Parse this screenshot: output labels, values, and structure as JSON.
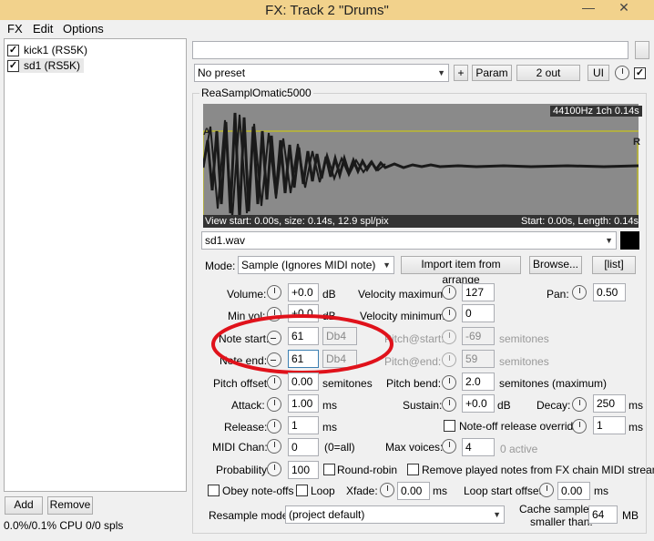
{
  "window": {
    "title": "FX: Track 2 \"Drums\"",
    "minimize": "—",
    "close": "✕"
  },
  "menu": {
    "fx": "FX",
    "edit": "Edit",
    "options": "Options"
  },
  "fx_list": [
    {
      "name": "kick1 (RS5K)",
      "checked": true
    },
    {
      "name": "sd1 (RS5K)",
      "checked": true
    }
  ],
  "footer": {
    "add": "Add",
    "remove": "Remove",
    "cpu": "0.0%/0.1% CPU 0/0 spls"
  },
  "top": {
    "preset": "No preset",
    "plus": "+",
    "param": "Param",
    "out": "2 out",
    "ui": "UI"
  },
  "plugin": {
    "name": "ReaSamplOmatic5000"
  },
  "waveform": {
    "info": "44100Hz 1ch 0.14s",
    "view": "View start: 0.00s, size: 0.14s, 12.9 spl/pix",
    "start": "Start: 0.00s, Length: 0.14s",
    "marker_a": "A",
    "marker_r": "R"
  },
  "file": {
    "name": "sd1.wav"
  },
  "mode": {
    "label": "Mode:",
    "value": "Sample (Ignores MIDI note)",
    "import": "Import item from arrange",
    "browse": "Browse...",
    "list": "[list]"
  },
  "params": {
    "volume_label": "Volume:",
    "volume": "+0.0",
    "db": "dB",
    "minvol_label": "Min vol:",
    "minvol": "+0.0",
    "vmax_label": "Velocity maximum:",
    "vmax": "127",
    "vmin_label": "Velocity minimum:",
    "vmin": "0",
    "pan_label": "Pan:",
    "pan": "0.50",
    "note_start_label": "Note start:",
    "note_start": "61",
    "note_start_name": "Db4",
    "note_end_label": "Note end:",
    "note_end": "61",
    "note_end_name": "Db4",
    "pitch_start_label": "Pitch@start:",
    "pitch_start": "-69",
    "pitch_end_label": "Pitch@end:",
    "pitch_end": "59",
    "semitones": "semitones",
    "pitch_offset_label": "Pitch offset",
    "pitch_offset": "0.00",
    "pitch_bend_label": "Pitch bend:",
    "pitch_bend": "2.0",
    "semitones_max": "semitones (maximum)",
    "attack_label": "Attack:",
    "attack": "1.00",
    "ms": "ms",
    "sustain_label": "Sustain:",
    "sustain": "+0.0",
    "decay_label": "Decay:",
    "decay": "250",
    "release_label": "Release:",
    "release": "1",
    "noteoff_label": "Note-off release override:",
    "noteoff": "1",
    "midichan_label": "MIDI Chan:",
    "midichan": "0",
    "midichan_all": "(0=all)",
    "maxvoices_label": "Max voices:",
    "maxvoices": "4",
    "active": "0 active",
    "prob_label": "Probability:",
    "prob": "100",
    "roundrobin": "Round-robin",
    "remove_played": "Remove played notes from FX chain MIDI stream",
    "obey": "Obey note-offs",
    "loop": "Loop",
    "xfade_label": "Xfade:",
    "xfade": "0.00",
    "loopstart_label": "Loop start offset:",
    "loopstart": "0.00",
    "resample_label": "Resample mode:",
    "resample": "(project default)",
    "cache_label1": "Cache samples",
    "cache_label2": "smaller than:",
    "cache": "64",
    "mb": "MB"
  },
  "colors": {
    "title_bg": "#f2d28c",
    "wave_bg": "#8a8a8a",
    "annotation": "#e0121b"
  }
}
